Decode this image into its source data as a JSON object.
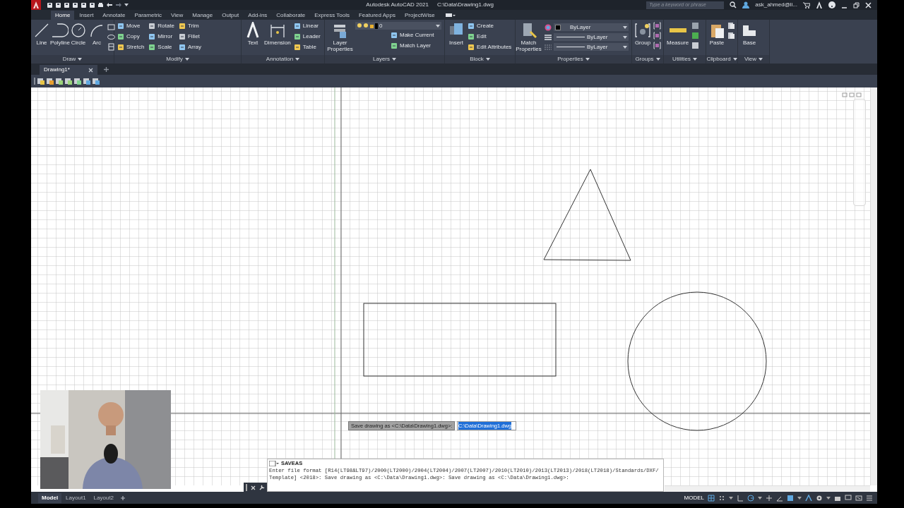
{
  "window": {
    "app": "Autodesk AutoCAD 2021",
    "file": "C:\\Data\\Drawing1.dwg"
  },
  "search": {
    "placeholder": "Type a keyword or phrase"
  },
  "user": "ask_ahmed@li...",
  "tabs": [
    {
      "label": "Home",
      "selected": true
    },
    {
      "label": "Insert",
      "selected": false
    },
    {
      "label": "Annotate",
      "selected": false
    },
    {
      "label": "Parametric",
      "selected": false
    },
    {
      "label": "View",
      "selected": false
    },
    {
      "label": "Manage",
      "selected": false
    },
    {
      "label": "Output",
      "selected": false
    },
    {
      "label": "Add-ins",
      "selected": false
    },
    {
      "label": "Collaborate",
      "selected": false
    },
    {
      "label": "Express Tools",
      "selected": false
    },
    {
      "label": "Featured Apps",
      "selected": false
    },
    {
      "label": "ProjectWise",
      "selected": false
    }
  ],
  "panels": [
    {
      "title": "Draw",
      "large": [
        "Line",
        "Polyline",
        "Circle",
        "Arc"
      ]
    },
    {
      "title": "Modify",
      "small": [
        "Move",
        "Copy",
        "Stretch",
        "Rotate",
        "Mirror",
        "Scale",
        "Trim",
        "Fillet",
        "Array"
      ]
    },
    {
      "title": "Annotation",
      "large": [
        "Text",
        "Dimension"
      ],
      "small": [
        "Linear",
        "Leader",
        "Table"
      ]
    },
    {
      "title": "Layers",
      "large": [
        "Layer Properties"
      ],
      "small": [
        "Make Current",
        "Match Layer"
      ],
      "fields": [
        "0"
      ]
    },
    {
      "title": "Block",
      "large": [
        "Insert"
      ],
      "small": [
        "Create",
        "Edit",
        "Edit Attributes"
      ]
    },
    {
      "title": "Properties",
      "large": [
        "Match Properties"
      ],
      "fields": [
        "ByLayer",
        "ByLayer",
        "ByLayer"
      ]
    },
    {
      "title": "Groups",
      "large": [
        "Group"
      ]
    },
    {
      "title": "Utilities",
      "large": [
        "Measure"
      ]
    },
    {
      "title": "Clipboard",
      "large": [
        "Paste"
      ]
    },
    {
      "title": "View",
      "large": [
        "Base"
      ]
    }
  ],
  "document_tabs": [
    {
      "label": "Drawing1*",
      "selected": true
    }
  ],
  "dynamic_input": {
    "prompt": "Save drawing as <C:\\Data\\Drawing1.dwg>:",
    "value": "C:\\Data\\Drawing1.dwg",
    "highlighted": true
  },
  "command_line": {
    "title": "SAVEAS",
    "lines": [
      "Enter file format [R14(LT98&LT97)/2000(LT2000)/2004(LT2004)/2007(LT2007)/2010(LT2010)/2013(LT2013)/2018(LT2018)/Standards/DXF/",
      "Template] <2018>: Save drawing as <C:\\Data\\Drawing1.dwg>: Save drawing as <C:\\Data\\Drawing1.dwg>:"
    ]
  },
  "layout_tabs": [
    {
      "label": "Model",
      "selected": true
    },
    {
      "label": "Layout1",
      "selected": false
    },
    {
      "label": "Layout2",
      "selected": false
    }
  ],
  "status": {
    "space": "MODEL"
  }
}
